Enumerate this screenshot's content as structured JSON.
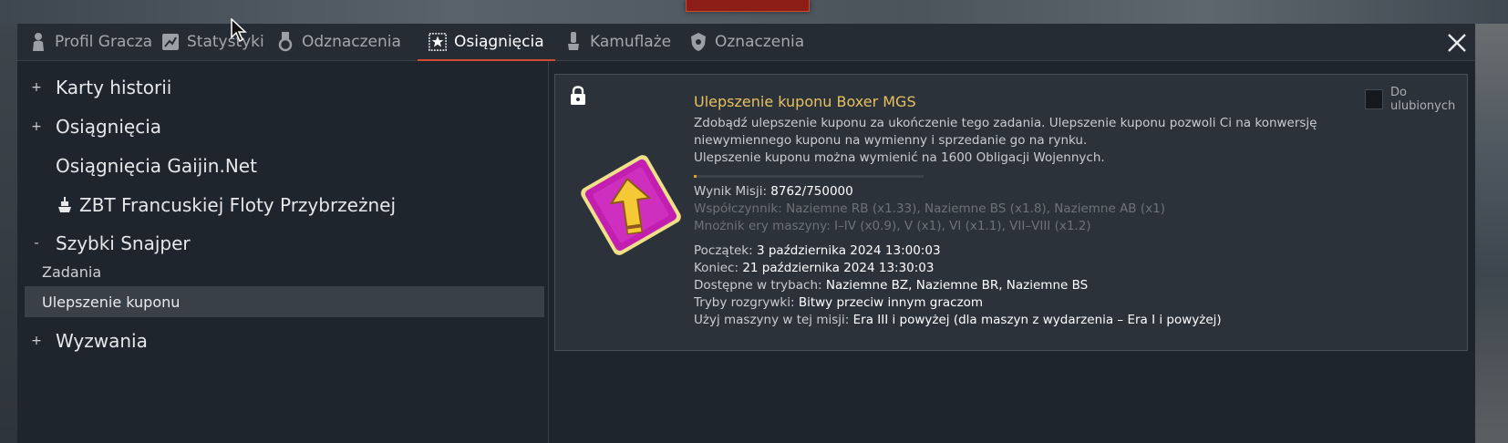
{
  "tabs": [
    {
      "label": "Profil Gracza",
      "icon": "soldier-icon",
      "active": false
    },
    {
      "label": "Statystyki",
      "icon": "stats-icon",
      "active": false
    },
    {
      "label": "Odznaczenia",
      "icon": "medal-icon",
      "active": false
    },
    {
      "label": "Osiągnięcia",
      "icon": "star-icon",
      "active": true
    },
    {
      "label": "Kamuflaże",
      "icon": "paint-icon",
      "active": false
    },
    {
      "label": "Oznaczenia",
      "icon": "decal-icon",
      "active": false
    }
  ],
  "tree": {
    "items": [
      {
        "expander": "+",
        "label": "Karty historii"
      },
      {
        "expander": "+",
        "label": "Osiągnięcia"
      },
      {
        "expander": "",
        "label": "Osiągnięcia Gaijin.Net"
      },
      {
        "expander": "",
        "label": "ZBT Francuskiej Floty Przybrzeżnej",
        "icon": "ship-icon"
      },
      {
        "expander": "-",
        "label": "Szybki Snajper"
      },
      {
        "expander": "+",
        "label": "Wyzwania"
      }
    ],
    "sub_items": [
      {
        "label": "Zadania",
        "selected": false
      },
      {
        "label": "Ulepszenie kuponu",
        "selected": true
      }
    ]
  },
  "detail": {
    "favorite_label": "Do ulubionych",
    "title": "Ulepszenie kuponu Boxer MGS",
    "description_1": "Zdobądź ulepszenie kuponu za ukończenie tego zadania. Ulepszenie kuponu pozwoli Ci na konwersję niewymiennego kuponu na wymienny i sprzedanie go na rynku.",
    "description_2": "Ulepszenie kuponu można wymienić na 1600 Obligacji Wojennych.",
    "progress_fraction": 0.0117,
    "score_label": "Wynik Misji:",
    "score_value": "8762/750000",
    "coef_line": "Współczynnik: Naziemne RB (x1.33), Naziemne BS (x1.8), Naziemne AB (x1)",
    "era_line": "Mnożnik ery maszyny: I–IV (x0.9), V (x1), VI (x1.1), VII–VIII (x1.2)",
    "start_label": "Początek:",
    "start_value": "3 października 2024 13:00:03",
    "end_label": "Koniec:",
    "end_value": "21 października 2024 13:30:03",
    "modes_label": "Dostępne w trybach:",
    "modes_value": "Naziemne BZ, Naziemne BR, Naziemne BS",
    "game_modes_label": "Tryby rozgrywki:",
    "game_modes_value": "Bitwy przeciw innym graczom",
    "vehicles_label": "Użyj maszyny w tej misji:",
    "vehicles_value": "Era III i powyżej (dla maszyn z wydarzenia – Era I i powyżej)"
  },
  "colors": {
    "accent_tab": "#d24a30",
    "title_gold": "#e8c060",
    "progress": "#e4a21c",
    "coupon_magenta": "#c21fb0"
  }
}
